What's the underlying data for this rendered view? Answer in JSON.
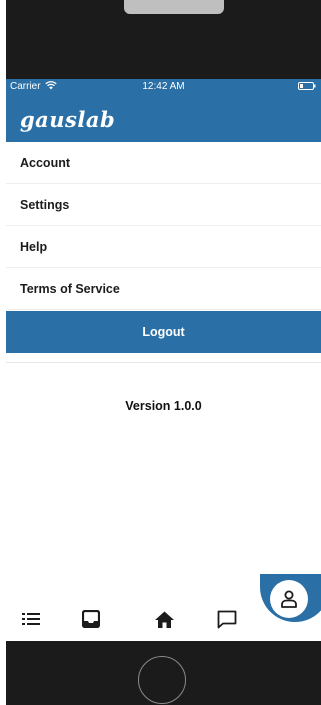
{
  "status_bar": {
    "carrier": "Carrier",
    "time": "12:42 AM",
    "wifi_icon": "wifi-icon",
    "battery_icon": "battery-icon"
  },
  "header": {
    "brand": "gauslab"
  },
  "menu": {
    "items": [
      {
        "label": "Account"
      },
      {
        "label": "Settings"
      },
      {
        "label": "Help"
      },
      {
        "label": "Terms of Service"
      }
    ],
    "logout_label": "Logout"
  },
  "version_text": "Version 1.0.0",
  "tab_bar": {
    "tabs": [
      {
        "icon": "list-icon"
      },
      {
        "icon": "inbox-icon"
      },
      {
        "icon": "home-icon"
      },
      {
        "icon": "chat-icon"
      },
      {
        "icon": "profile-icon",
        "active": true
      }
    ]
  },
  "colors": {
    "brand_blue": "#2a6fa5",
    "device_frame": "#1b1b1b",
    "text_dark": "#1c1c1c"
  }
}
